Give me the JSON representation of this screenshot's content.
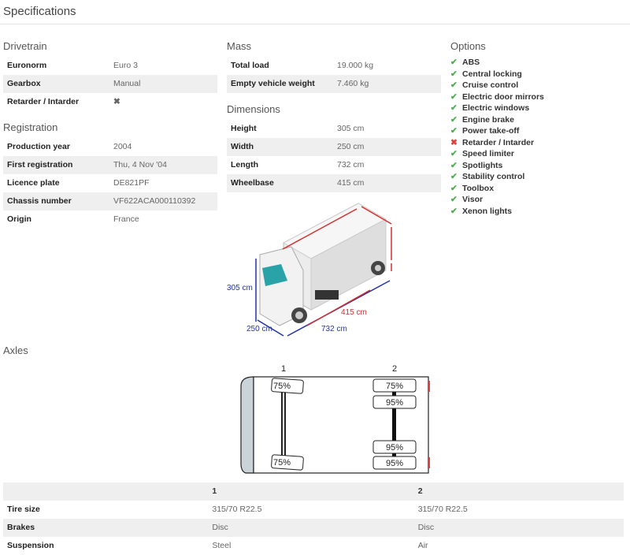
{
  "title": "Specifications",
  "drivetrain": {
    "heading": "Drivetrain",
    "rows": [
      {
        "k": "Euronorm",
        "v": "Euro 3"
      },
      {
        "k": "Gearbox",
        "v": "Manual"
      },
      {
        "k": "Retarder / Intarder",
        "v": "✖"
      }
    ]
  },
  "registration": {
    "heading": "Registration",
    "rows": [
      {
        "k": "Production year",
        "v": "2004"
      },
      {
        "k": "First registration",
        "v": "Thu, 4 Nov '04"
      },
      {
        "k": "Licence plate",
        "v": "DE821PF"
      },
      {
        "k": "Chassis number",
        "v": "VF622ACA000110392"
      },
      {
        "k": "Origin",
        "v": "France"
      }
    ]
  },
  "mass": {
    "heading": "Mass",
    "rows": [
      {
        "k": "Total load",
        "v": "19.000 kg"
      },
      {
        "k": "Empty vehicle weight",
        "v": "7.460 kg"
      }
    ]
  },
  "dimensions": {
    "heading": "Dimensions",
    "rows": [
      {
        "k": "Height",
        "v": "305 cm"
      },
      {
        "k": "Width",
        "v": "250 cm"
      },
      {
        "k": "Length",
        "v": "732 cm"
      },
      {
        "k": "Wheelbase",
        "v": "415 cm"
      }
    ]
  },
  "diagram": {
    "height": "305 cm",
    "width": "250 cm",
    "length": "732 cm",
    "wheelbase": "415 cm"
  },
  "options": {
    "heading": "Options",
    "items": [
      {
        "label": "ABS",
        "ok": true
      },
      {
        "label": "Central locking",
        "ok": true
      },
      {
        "label": "Cruise control",
        "ok": true
      },
      {
        "label": "Electric door mirrors",
        "ok": true
      },
      {
        "label": "Electric windows",
        "ok": true
      },
      {
        "label": "Engine brake",
        "ok": true
      },
      {
        "label": "Power take-off",
        "ok": true
      },
      {
        "label": "Retarder / Intarder",
        "ok": false
      },
      {
        "label": "Speed limiter",
        "ok": true
      },
      {
        "label": "Spotlights",
        "ok": true
      },
      {
        "label": "Stability control",
        "ok": true
      },
      {
        "label": "Toolbox",
        "ok": true
      },
      {
        "label": "Visor",
        "ok": true
      },
      {
        "label": "Xenon lights",
        "ok": true
      }
    ]
  },
  "axles": {
    "heading": "Axles",
    "axle1": {
      "num": "1",
      "tl": "75%",
      "bl": "75%"
    },
    "axle2": {
      "num": "2",
      "t1": "75%",
      "t2": "95%",
      "b1": "95%",
      "b2": "95%"
    },
    "table": {
      "header": [
        "",
        "1",
        "2"
      ],
      "rows": [
        {
          "k": "Tire size",
          "a": "315/70 R22.5",
          "b": "315/70 R22.5"
        },
        {
          "k": "Brakes",
          "a": "Disc",
          "b": "Disc"
        },
        {
          "k": "Suspension",
          "a": "Steel",
          "b": "Air"
        }
      ]
    }
  },
  "colors": {
    "check": "#4caf50",
    "cross": "#e0403a",
    "dim_blue": "#2233aa",
    "dim_red": "#d03030"
  }
}
